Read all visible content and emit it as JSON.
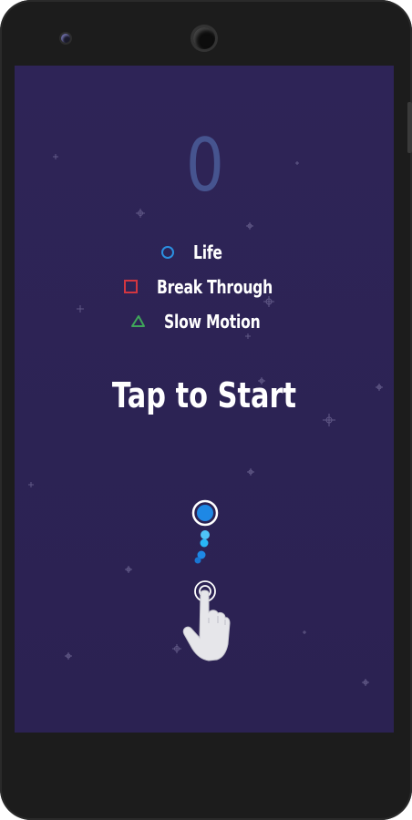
{
  "device": {
    "icons": [
      "camera-icon",
      "sensor-icon"
    ]
  },
  "game": {
    "score": "0",
    "legend": [
      {
        "shape": "circle",
        "color": "#2b8fe0",
        "label": "Life"
      },
      {
        "shape": "square",
        "color": "#d23640",
        "label": "Break Through"
      },
      {
        "shape": "triangle",
        "color": "#3fa65a",
        "label": "Slow Motion"
      }
    ],
    "prompt": "Tap to Start",
    "colors": {
      "background": "#2c2354",
      "score": "#46548f",
      "ball": "#1e88e5",
      "trail": "#29b6f6"
    },
    "icons": [
      "ball-icon",
      "hand-pointer-icon",
      "star-icon"
    ]
  }
}
